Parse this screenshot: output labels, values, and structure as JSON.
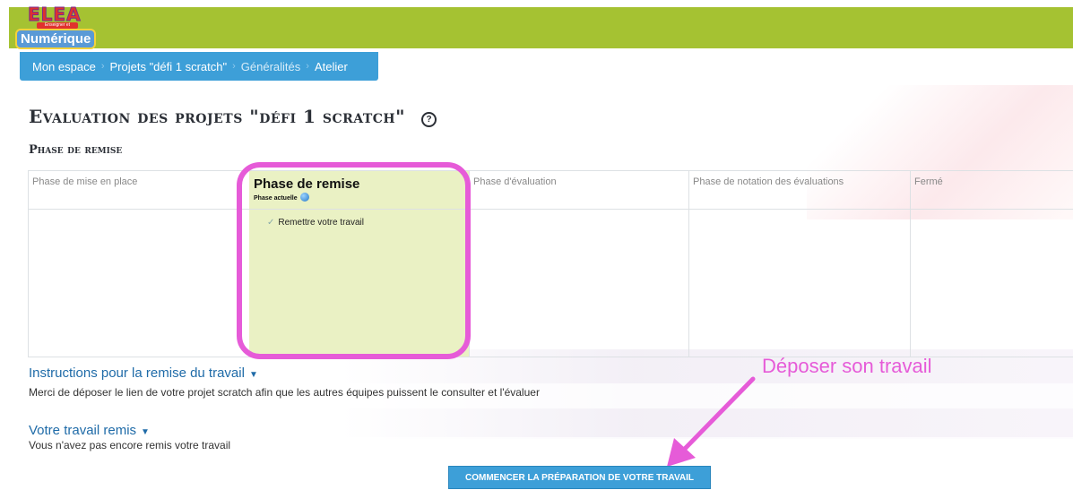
{
  "logo": {
    "line1": "ELEA",
    "tagline": "Enseigner et Apprendre",
    "line2": "Numérique"
  },
  "breadcrumb": [
    "Mon espace",
    "Projets \"défi 1 scratch\"",
    "Généralités",
    "Atelier"
  ],
  "page": {
    "title": "Evaluation des projets \"défi 1 scratch\"",
    "subtitle": "Phase de remise"
  },
  "phases": [
    {
      "name": "Phase de mise en place"
    },
    {
      "name": "Phase de remise",
      "status": "Phase actuelle",
      "tasks": [
        "Remettre votre travail"
      ]
    },
    {
      "name": "Phase d'évaluation"
    },
    {
      "name": "Phase de notation des évaluations"
    },
    {
      "name": "Fermé"
    }
  ],
  "instructions": {
    "heading": "Instructions pour la remise du travail",
    "text": "Merci de déposer le lien de votre projet scratch afin que les autres équipes puissent le consulter et l'évaluer"
  },
  "submission": {
    "heading": "Votre travail remis",
    "text": "Vous n'avez pas encore remis votre travail",
    "button": "COMMENCER LA PRÉPARATION DE VOTRE TRAVAIL"
  },
  "annotation": {
    "label": "Déposer son travail",
    "color": "#e65bd8"
  },
  "colors": {
    "topbar": "#a5c232",
    "breadcrumb": "#3d9fd8",
    "active_phase": "#eaf1c4",
    "link": "#1f6ba8"
  },
  "icons": {
    "help": "question-circle-icon",
    "bulb": "lightbulb-icon",
    "check": "checkmark-icon",
    "caret": "caret-down-icon"
  }
}
